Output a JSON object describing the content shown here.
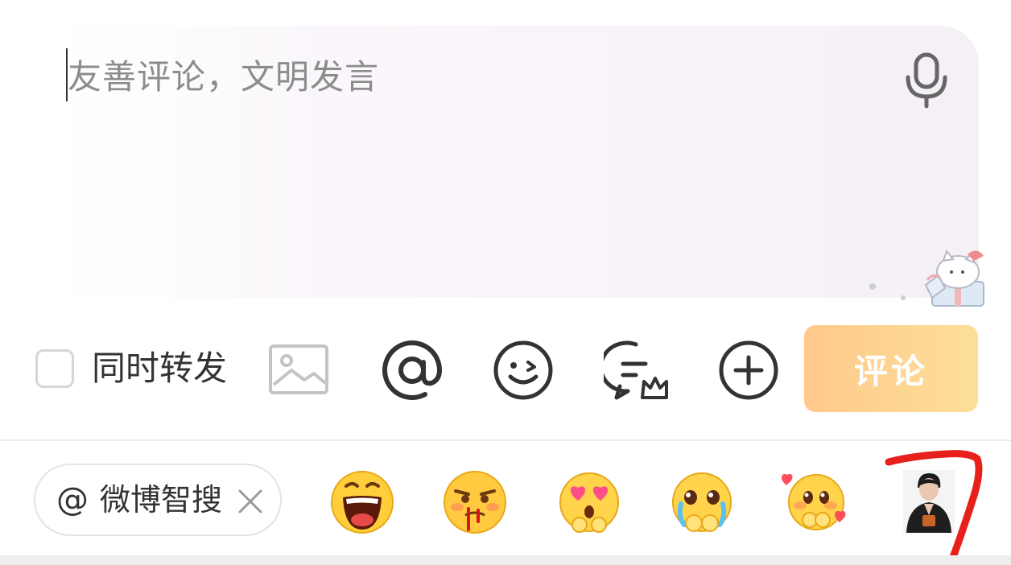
{
  "composer": {
    "placeholder": "友善评论，文明发言"
  },
  "toolbar": {
    "repost_label": "同时转发",
    "repost_checked": false,
    "submit_label": "评论",
    "icons": [
      "image-icon",
      "at-mention-icon",
      "emoji-icon",
      "topic-chat-icon",
      "add-icon"
    ]
  },
  "suggestions": {
    "search_chip": {
      "at_symbol": "@",
      "label": "微博智搜"
    },
    "emojis": [
      "laughing-emoji",
      "nosebleed-emoji",
      "heart-eyes-emoji",
      "crying-emoji",
      "shy-emoji"
    ]
  },
  "colors": {
    "submit_gradient_start": "#ffc98a",
    "submit_gradient_end": "#fddf9a",
    "placeholder_text": "#8c8c8c",
    "annotation_red": "#e8201c"
  }
}
